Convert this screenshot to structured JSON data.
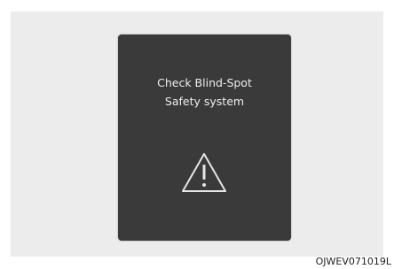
{
  "display": {
    "message_line1": "Check Blind-Spot",
    "message_line2": "Safety system",
    "icon": "warning-triangle-icon",
    "colors": {
      "screen": "#3a3a3a",
      "text": "#eeeeee",
      "frame": "#ececec"
    }
  },
  "caption": {
    "code": "OJWEV071019L"
  }
}
